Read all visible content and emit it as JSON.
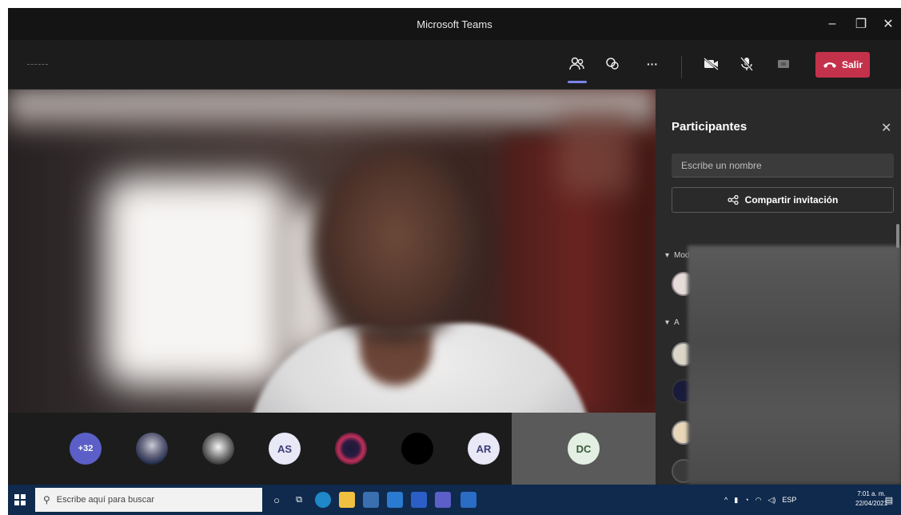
{
  "window": {
    "title": "Microsoft Teams",
    "controls": {
      "minimize": "–",
      "maximize": "❐",
      "close": "✕"
    }
  },
  "toolbar": {
    "people_icon": "people-icon",
    "chat_icon": "chat-icon",
    "more_label": "···",
    "camera_icon": "camera-off-icon",
    "mic_icon": "mic-off-icon",
    "share_icon": "share-screen-icon",
    "leave_label": "Salir",
    "leave_color": "#c4314b",
    "active_tab_color": "#7b83eb"
  },
  "tray": {
    "avatars": [
      {
        "label": "+32",
        "kind": "more"
      },
      {
        "label": "",
        "kind": "photo"
      },
      {
        "label": "",
        "kind": "photo"
      },
      {
        "label": "AS",
        "kind": "initials"
      },
      {
        "label": "",
        "kind": "photo"
      },
      {
        "label": "",
        "kind": "black"
      },
      {
        "label": "AR",
        "kind": "initials"
      }
    ],
    "tile": {
      "label": "DC"
    }
  },
  "panel": {
    "title": "Participantes",
    "close": "✕",
    "search_placeholder": "Escribe un nombre",
    "share_label": "Compartir invitación",
    "section_moderators": "Moderadores (1)",
    "section_attendees": "A"
  },
  "taskbar": {
    "search_placeholder": "Escribe aquí para buscar",
    "language": "ESP",
    "time": "7:01 a. m.",
    "date": "22/04/2021"
  }
}
